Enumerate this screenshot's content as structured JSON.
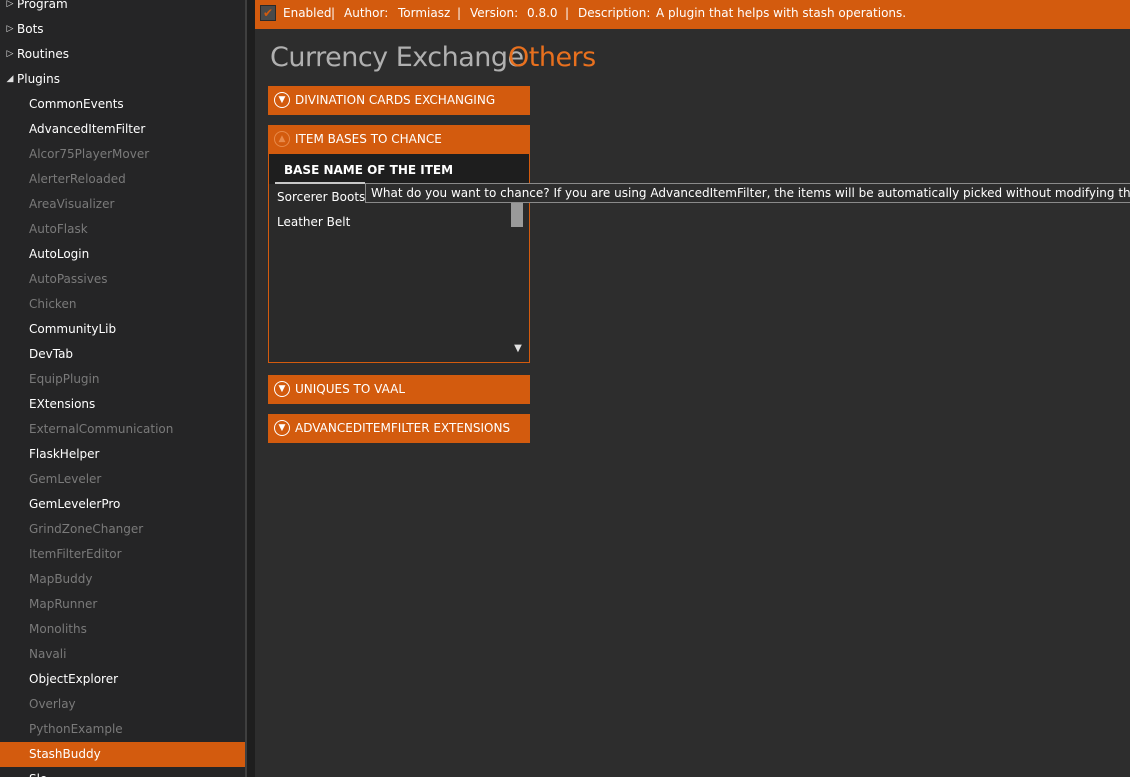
{
  "sidebar": {
    "top_items": [
      {
        "label": "Program",
        "arrow": "▷"
      },
      {
        "label": "Bots",
        "arrow": "▷"
      },
      {
        "label": "Routines",
        "arrow": "▷"
      },
      {
        "label": "Plugins",
        "arrow": "◢"
      }
    ],
    "plugins": [
      {
        "label": "CommonEvents",
        "enabled": true
      },
      {
        "label": "AdvancedItemFilter",
        "enabled": true
      },
      {
        "label": "Alcor75PlayerMover",
        "enabled": false
      },
      {
        "label": "AlerterReloaded",
        "enabled": false
      },
      {
        "label": "AreaVisualizer",
        "enabled": false
      },
      {
        "label": "AutoFlask",
        "enabled": false
      },
      {
        "label": "AutoLogin",
        "enabled": true
      },
      {
        "label": "AutoPassives",
        "enabled": false
      },
      {
        "label": "Chicken",
        "enabled": false
      },
      {
        "label": "CommunityLib",
        "enabled": true
      },
      {
        "label": "DevTab",
        "enabled": true
      },
      {
        "label": "EquipPlugin",
        "enabled": false
      },
      {
        "label": "EXtensions",
        "enabled": true
      },
      {
        "label": "ExternalCommunication",
        "enabled": false
      },
      {
        "label": "FlaskHelper",
        "enabled": true
      },
      {
        "label": "GemLeveler",
        "enabled": false
      },
      {
        "label": "GemLevelerPro",
        "enabled": true
      },
      {
        "label": "GrindZoneChanger",
        "enabled": false
      },
      {
        "label": "ItemFilterEditor",
        "enabled": false
      },
      {
        "label": "MapBuddy",
        "enabled": false
      },
      {
        "label": "MapRunner",
        "enabled": false
      },
      {
        "label": "Monoliths",
        "enabled": false
      },
      {
        "label": "Navali",
        "enabled": false
      },
      {
        "label": "ObjectExplorer",
        "enabled": true
      },
      {
        "label": "Overlay",
        "enabled": false
      },
      {
        "label": "PythonExample",
        "enabled": false
      },
      {
        "label": "StashBuddy",
        "enabled": true,
        "selected": true
      },
      {
        "label": "Slo",
        "enabled": true
      }
    ]
  },
  "topbar": {
    "enabled_checked": true,
    "enabled_label": "Enabled",
    "sep1": "|",
    "author_label": "Author:",
    "author_value": "Tormiasz",
    "sep2": "|",
    "version_label": "Version:",
    "version_value": "0.8.0",
    "sep3": "|",
    "description_label": "Description:",
    "description_value": "A plugin that helps with stash operations."
  },
  "tabs": {
    "tab1": "Currency Exchange",
    "tab2": "Others"
  },
  "sections": {
    "divination": "DIVINATION CARDS EXCHANGING",
    "item_bases": "ITEM BASES TO CHANCE",
    "uniques": "UNIQUES TO VAAL",
    "aif_ext": "ADVANCEDITEMFILTER EXTENSIONS"
  },
  "chance_table": {
    "column_header": "BASE NAME OF THE ITEM",
    "rows": [
      "Sorcerer Boots",
      "Leather Belt"
    ]
  },
  "tooltip": "What do you want to chance? If you are using AdvancedItemFilter, the items will be automatically picked without modifying the filter.",
  "colors": {
    "accent": "#d35b0e",
    "background": "#2d2d2d",
    "sidebar": "#252526"
  }
}
